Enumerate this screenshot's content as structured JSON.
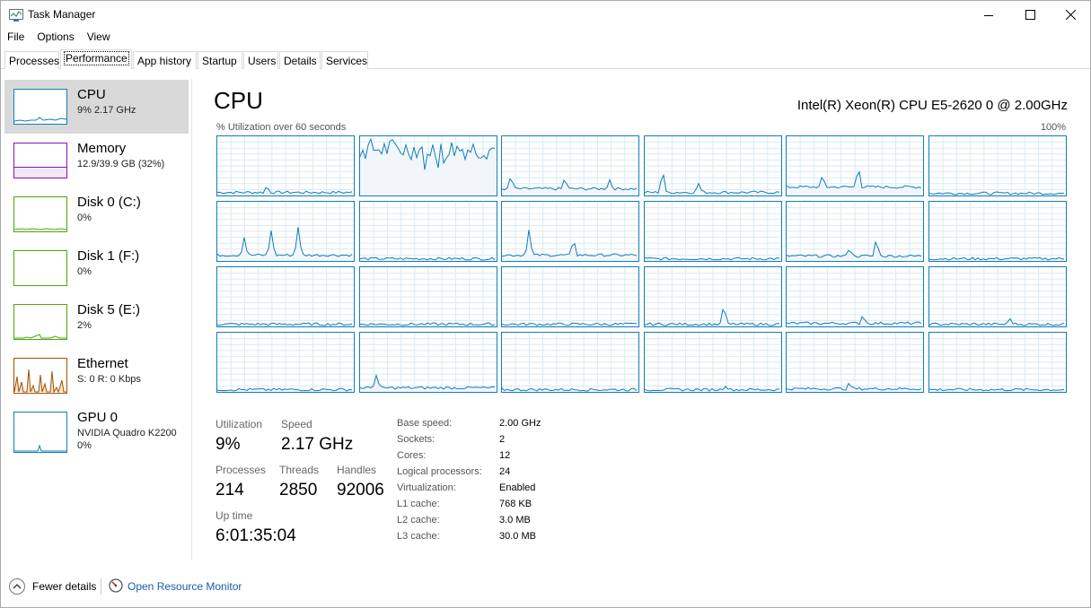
{
  "window": {
    "title": "Task Manager"
  },
  "menu": [
    "File",
    "Options",
    "View"
  ],
  "tabs": [
    "Processes",
    "Performance",
    "App history",
    "Startup",
    "Users",
    "Details",
    "Services"
  ],
  "active_tab": "Performance",
  "sidebar": {
    "items": [
      {
        "name": "CPU",
        "sub": "9%  2.17 GHz",
        "sub2": "",
        "color": "#117dbb"
      },
      {
        "name": "Memory",
        "sub": "12.9/39.9 GB (32%)",
        "sub2": "",
        "color": "#8b12ae"
      },
      {
        "name": "Disk 0 (C:)",
        "sub": "0%",
        "sub2": "",
        "color": "#4da60c"
      },
      {
        "name": "Disk 1 (F:)",
        "sub": "0%",
        "sub2": "",
        "color": "#4da60c"
      },
      {
        "name": "Disk 5 (E:)",
        "sub": "2%",
        "sub2": "",
        "color": "#4da60c"
      },
      {
        "name": "Ethernet",
        "sub": "S: 0  R: 0 Kbps",
        "sub2": "",
        "color": "#a74f01"
      },
      {
        "name": "GPU 0",
        "sub": "NVIDIA Quadro K2200",
        "sub2": "0%",
        "color": "#117dbb"
      }
    ]
  },
  "main": {
    "title": "CPU",
    "processor": "Intel(R) Xeon(R) CPU E5-2620 0 @ 2.00GHz",
    "util_label": "% Utilization over 60 seconds",
    "util_max": "100%"
  },
  "stats": {
    "utilization_label": "Utilization",
    "utilization": "9%",
    "speed_label": "Speed",
    "speed": "2.17 GHz",
    "processes_label": "Processes",
    "processes": "214",
    "threads_label": "Threads",
    "threads": "2850",
    "handles_label": "Handles",
    "handles": "92006",
    "uptime_label": "Up time",
    "uptime": "6:01:35:04"
  },
  "specs": [
    {
      "label": "Base speed:",
      "value": "2.00 GHz"
    },
    {
      "label": "Sockets:",
      "value": "2"
    },
    {
      "label": "Cores:",
      "value": "12"
    },
    {
      "label": "Logical processors:",
      "value": "24"
    },
    {
      "label": "Virtualization:",
      "value": "Enabled"
    },
    {
      "label": "L1 cache:",
      "value": "768 KB"
    },
    {
      "label": "L2 cache:",
      "value": "3.0 MB"
    },
    {
      "label": "L3 cache:",
      "value": "30.0 MB"
    }
  ],
  "footer": {
    "fewer": "Fewer details",
    "resmon": "Open Resource Monitor"
  },
  "icons": {
    "minimize": "minimize-icon",
    "maximize": "maximize-icon",
    "close": "close-icon",
    "fewer": "chevron-up-icon",
    "resmon": "resource-monitor-icon"
  },
  "colors": {
    "cpu": "#117dbb",
    "cpu_fill": "#f1f6fa",
    "grid": "#d9eaf4"
  }
}
